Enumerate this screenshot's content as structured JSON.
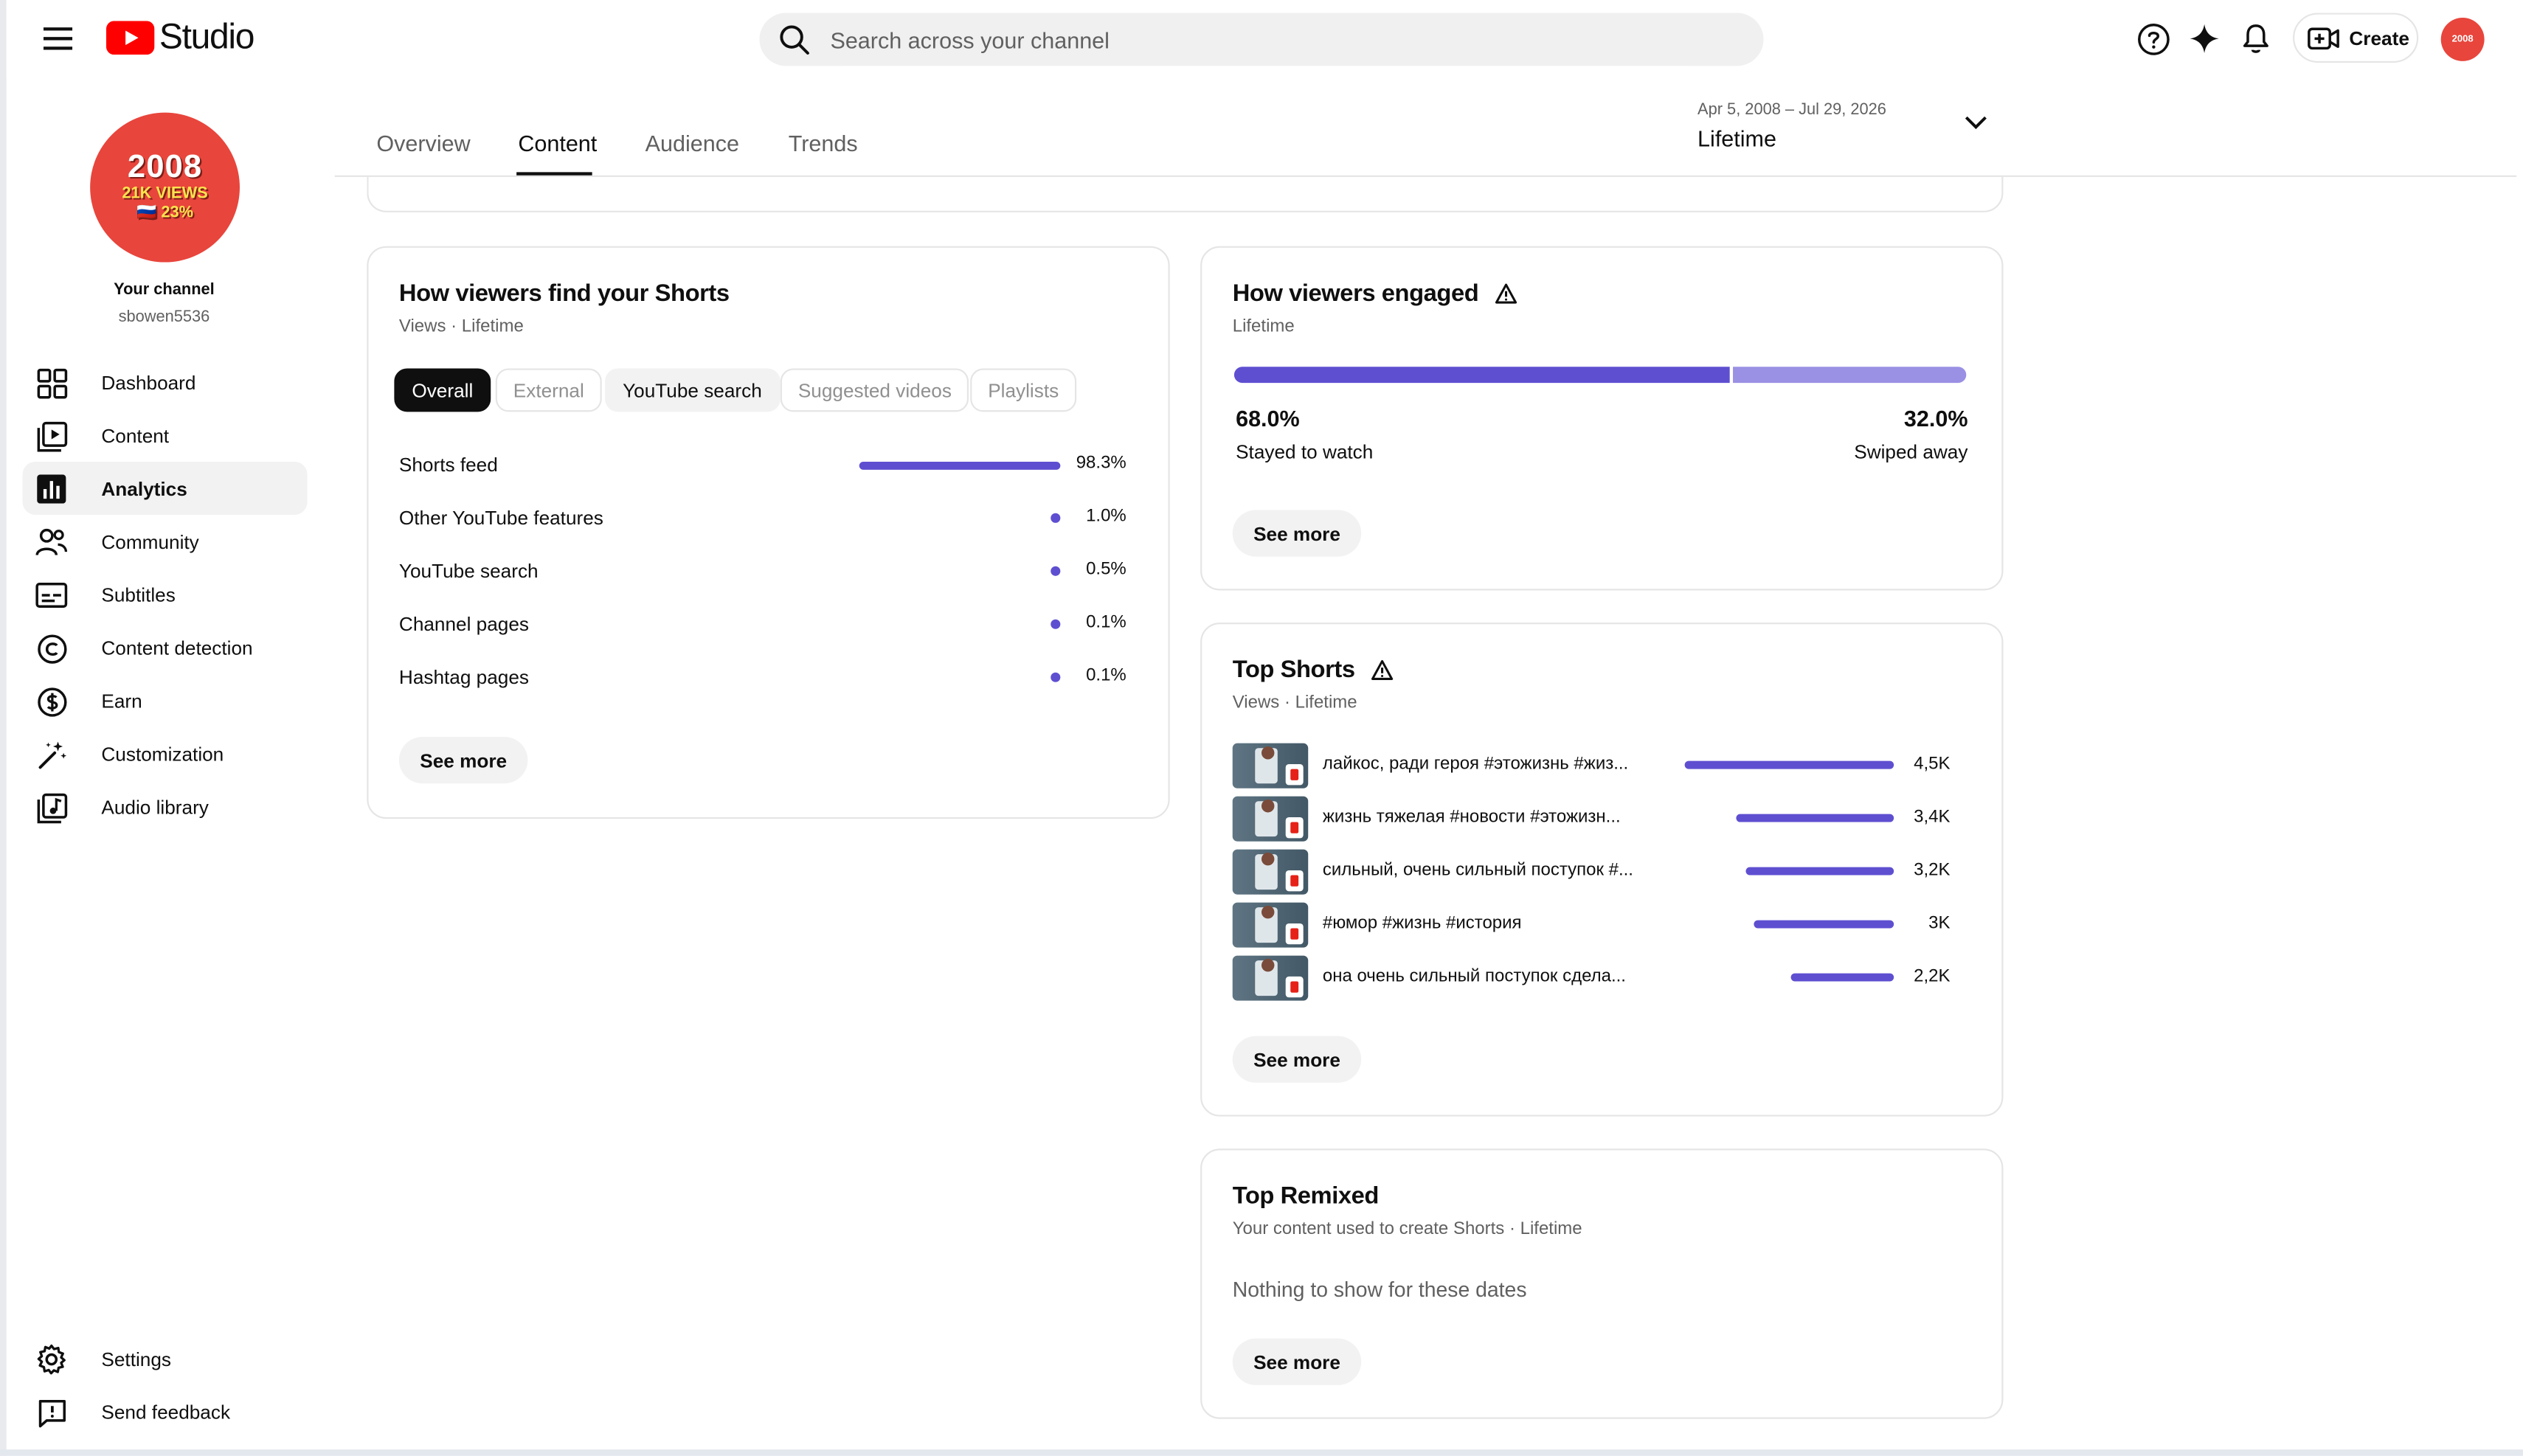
{
  "app": {
    "name": "Studio"
  },
  "search": {
    "placeholder": "Search across your channel"
  },
  "header": {
    "create_label": "Create",
    "avatar_text": "2008"
  },
  "channel": {
    "avatar_line1": "2008",
    "avatar_line2": "21K VIEWS",
    "avatar_line3": "🇷🇺 23%",
    "title": "Your channel",
    "handle": "sbowen5536"
  },
  "sidebar": {
    "items": [
      {
        "label": "Dashboard",
        "icon": "dashboard-icon"
      },
      {
        "label": "Content",
        "icon": "content-icon"
      },
      {
        "label": "Analytics",
        "icon": "analytics-icon",
        "active": true
      },
      {
        "label": "Community",
        "icon": "community-icon"
      },
      {
        "label": "Subtitles",
        "icon": "subtitles-icon"
      },
      {
        "label": "Content detection",
        "icon": "copyright-icon"
      },
      {
        "label": "Earn",
        "icon": "dollar-icon"
      },
      {
        "label": "Customization",
        "icon": "magic-wand-icon"
      },
      {
        "label": "Audio library",
        "icon": "audio-library-icon"
      }
    ],
    "bottom": [
      {
        "label": "Settings",
        "icon": "gear-icon"
      },
      {
        "label": "Send feedback",
        "icon": "feedback-icon"
      }
    ]
  },
  "tabs": [
    "Overview",
    "Content",
    "Audience",
    "Trends"
  ],
  "active_tab": "Content",
  "date_range": {
    "range": "Apr 5, 2008 – Jul 29, 2026",
    "label": "Lifetime"
  },
  "find_shorts": {
    "title": "How viewers find your Shorts",
    "subtitle": "Views · Lifetime",
    "chips": [
      "Overall",
      "External",
      "YouTube search",
      "Suggested videos",
      "Playlists"
    ],
    "rows": [
      {
        "name": "Shorts feed",
        "value": "98.3%",
        "share": 98.3
      },
      {
        "name": "Other YouTube features",
        "value": "1.0%",
        "share": 1.0
      },
      {
        "name": "YouTube search",
        "value": "0.5%",
        "share": 0.5
      },
      {
        "name": "Channel pages",
        "value": "0.1%",
        "share": 0.1
      },
      {
        "name": "Hashtag pages",
        "value": "0.1%",
        "share": 0.1
      }
    ],
    "see_more": "See more"
  },
  "engaged": {
    "title": "How viewers engaged",
    "subtitle": "Lifetime",
    "stayed": {
      "value": "68.0%",
      "label": "Stayed to watch",
      "share": 68.0
    },
    "swiped": {
      "value": "32.0%",
      "label": "Swiped away",
      "share": 32.0
    },
    "see_more": "See more"
  },
  "top_shorts": {
    "title": "Top Shorts",
    "subtitle": "Views · Lifetime",
    "rows": [
      {
        "title": "лайкос, ради героя #этожизнь #жиз...",
        "value": "4,5K",
        "views": 4500
      },
      {
        "title": "жизнь тяжелая #новости #этожизн...",
        "value": "3,4K",
        "views": 3400
      },
      {
        "title": "сильный, очень сильный поступок #...",
        "value": "3,2K",
        "views": 3200
      },
      {
        "title": "#юмор #жизнь #история",
        "value": "3K",
        "views": 3000
      },
      {
        "title": "она очень сильный поступок сдела...",
        "value": "2,2K",
        "views": 2200
      }
    ],
    "see_more": "See more"
  },
  "top_remixed": {
    "title": "Top Remixed",
    "subtitle": "Your content used to create Shorts · Lifetime",
    "empty": "Nothing to show for these dates",
    "see_more": "See more"
  },
  "colors": {
    "accent": "#5e4fd1",
    "accent_light": "#9a90e4",
    "brand_red": "#ff0000"
  }
}
